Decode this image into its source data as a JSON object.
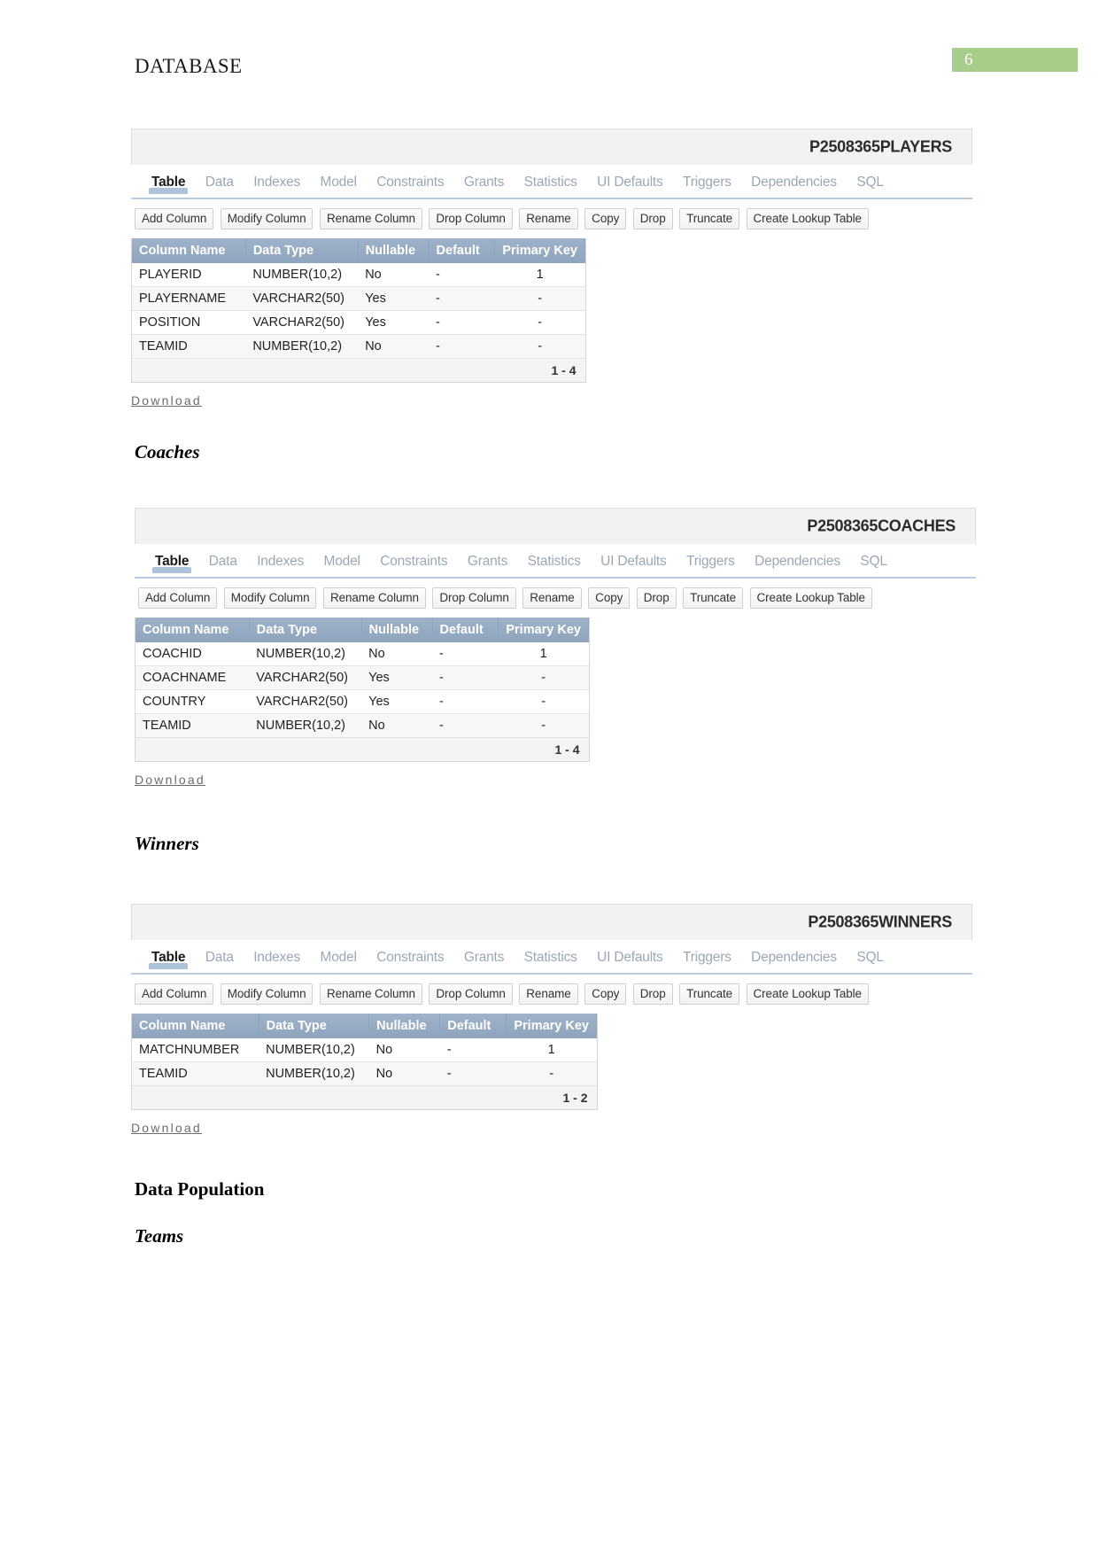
{
  "header": {
    "doc_title": "DATABASE",
    "page_number": "6"
  },
  "sections": [
    {
      "id": "coaches",
      "label": "Coaches",
      "style": "italic"
    },
    {
      "id": "winners",
      "label": "Winners",
      "style": "italic"
    },
    {
      "id": "data_population",
      "label": "Data Population",
      "style": "plain"
    },
    {
      "id": "teams",
      "label": "Teams",
      "style": "italic"
    }
  ],
  "apex_common": {
    "tabs": [
      "Table",
      "Data",
      "Indexes",
      "Model",
      "Constraints",
      "Grants",
      "Statistics",
      "UI Defaults",
      "Triggers",
      "Dependencies",
      "SQL"
    ],
    "active_tab": "Table",
    "buttons": [
      "Add Column",
      "Modify Column",
      "Rename Column",
      "Drop Column",
      "Rename",
      "Copy",
      "Drop",
      "Truncate",
      "Create Lookup Table"
    ],
    "grid_headers": [
      "Column Name",
      "Data Type",
      "Nullable",
      "Default",
      "Primary Key"
    ],
    "download_label": "Download"
  },
  "tables": [
    {
      "id": "players",
      "name": "P2508365PLAYERS",
      "rows": [
        {
          "column_name": "PLAYERID",
          "data_type": "NUMBER(10,2)",
          "nullable": "No",
          "default": "-",
          "primary_key": "1"
        },
        {
          "column_name": "PLAYERNAME",
          "data_type": "VARCHAR2(50)",
          "nullable": "Yes",
          "default": "-",
          "primary_key": "-"
        },
        {
          "column_name": "POSITION",
          "data_type": "VARCHAR2(50)",
          "nullable": "Yes",
          "default": "-",
          "primary_key": "-"
        },
        {
          "column_name": "TEAMID",
          "data_type": "NUMBER(10,2)",
          "nullable": "No",
          "default": "-",
          "primary_key": "-"
        }
      ],
      "row_range": "1 - 4"
    },
    {
      "id": "coaches",
      "name": "P2508365COACHES",
      "rows": [
        {
          "column_name": "COACHID",
          "data_type": "NUMBER(10,2)",
          "nullable": "No",
          "default": "-",
          "primary_key": "1"
        },
        {
          "column_name": "COACHNAME",
          "data_type": "VARCHAR2(50)",
          "nullable": "Yes",
          "default": "-",
          "primary_key": "-"
        },
        {
          "column_name": "COUNTRY",
          "data_type": "VARCHAR2(50)",
          "nullable": "Yes",
          "default": "-",
          "primary_key": "-"
        },
        {
          "column_name": "TEAMID",
          "data_type": "NUMBER(10,2)",
          "nullable": "No",
          "default": "-",
          "primary_key": "-"
        }
      ],
      "row_range": "1 - 4"
    },
    {
      "id": "winners",
      "name": "P2508365WINNERS",
      "rows": [
        {
          "column_name": "MATCHNUMBER",
          "data_type": "NUMBER(10,2)",
          "nullable": "No",
          "default": "-",
          "primary_key": "1"
        },
        {
          "column_name": "TEAMID",
          "data_type": "NUMBER(10,2)",
          "nullable": "No",
          "default": "-",
          "primary_key": "-"
        }
      ],
      "row_range": "1 - 2"
    }
  ],
  "colors": {
    "page_badge": "#a8cd8b",
    "grid_header": "#93a8c1",
    "tab_underline": "#b9cbe0"
  }
}
